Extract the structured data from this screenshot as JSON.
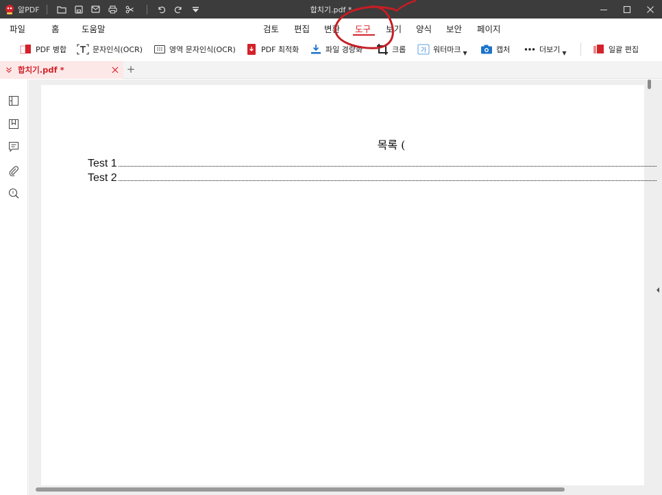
{
  "app": {
    "name": "알PDF",
    "window_title": "합치기.pdf *",
    "accent_color": "#d3222a"
  },
  "menu": {
    "items": [
      {
        "id": "file",
        "label": "파일"
      },
      {
        "id": "home",
        "label": "홈"
      },
      {
        "id": "help",
        "label": "도움말"
      },
      {
        "id": "review",
        "label": "검토"
      },
      {
        "id": "edit",
        "label": "편집"
      },
      {
        "id": "convert",
        "label": "변환"
      },
      {
        "id": "tools",
        "label": "도구",
        "active": true
      },
      {
        "id": "view",
        "label": "보기"
      },
      {
        "id": "form",
        "label": "양식"
      },
      {
        "id": "security",
        "label": "보안"
      },
      {
        "id": "page",
        "label": "페이지"
      }
    ]
  },
  "toolbar": {
    "merge": "PDF 병합",
    "ocr": "문자인식(OCR)",
    "area_ocr": "영역 문자인식(OCR)",
    "optimize": "PDF 최적화",
    "shrink": "파일 경량화",
    "crop": "크롭",
    "watermark": "워터마크",
    "capture": "캡처",
    "more": "더보기",
    "batch_edit": "일괄 편집"
  },
  "tabs": {
    "document": "합치기.pdf *",
    "add_label": "+"
  },
  "document": {
    "toc_title": "목록 (",
    "entries": [
      {
        "label": "Test 1"
      },
      {
        "label": "Test 2"
      }
    ]
  }
}
